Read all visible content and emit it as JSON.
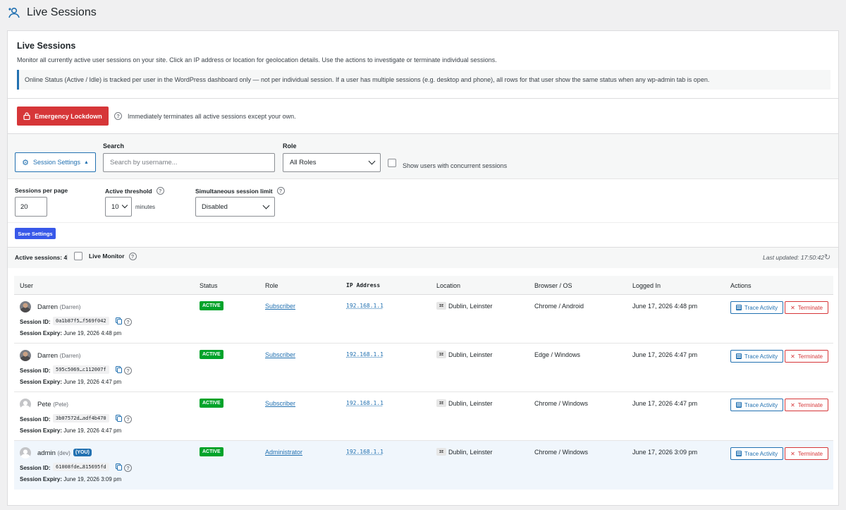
{
  "page": {
    "title": "Live Sessions"
  },
  "intro": {
    "title": "Live Sessions",
    "text": "Monitor all currently active user sessions on your site. Click an IP address or location for geolocation details. Use the actions to investigate or terminate individual sessions.",
    "notice": "Online Status (Active / Idle) is tracked per user in the WordPress dashboard only — not per individual session. If a user has multiple sessions (e.g. desktop and phone), all rows for that user show the same status when any wp-admin tab is open."
  },
  "lockdown": {
    "button_label": "Emergency Lockdown",
    "help_text": "Immediately terminates all active sessions except your own."
  },
  "filters": {
    "settings_button": "Session Settings",
    "search_label": "Search",
    "search_placeholder": "Search by username...",
    "role_label": "Role",
    "role_value": "All Roles",
    "concurrent_label": "Show users with concurrent sessions"
  },
  "settings": {
    "per_page_label": "Sessions per page",
    "per_page_value": "20",
    "threshold_label": "Active threshold",
    "threshold_value": "10",
    "threshold_unit": "minutes",
    "limit_label": "Simultaneous session limit",
    "limit_value": "Disabled",
    "save_label": "Save Settings"
  },
  "summary": {
    "active_sessions": "Active sessions: 4",
    "separator": "|",
    "live_monitor": "Live Monitor",
    "last_updated": "Last updated: 17:50:42"
  },
  "table": {
    "headers": [
      "User",
      "Status",
      "Role",
      "IP Address",
      "Location",
      "Browser / OS",
      "Logged In",
      "Actions"
    ],
    "session_id_label": "Session ID:",
    "session_expiry_label": "Session Expiry:",
    "trace_label": "Trace Activity",
    "terminate_label": "Terminate",
    "rows": [
      {
        "name": "Darren",
        "display": "(Darren)",
        "session_id": "0a1b87f5…f569f042",
        "expiry": "June 19, 2026 4:48 pm",
        "status": "ACTIVE",
        "role": "Subscriber",
        "ip": "192.168.1.1",
        "flag": "IE",
        "location": "Dublin, Leinster",
        "browser": "Chrome / Android",
        "logged_in": "June 17, 2026 4:48 pm"
      },
      {
        "name": "Darren",
        "display": "(Darren)",
        "session_id": "595c5069…c112007f",
        "expiry": "June 19, 2026 4:47 pm",
        "status": "ACTIVE",
        "role": "Subscriber",
        "ip": "192.168.1.1",
        "flag": "IE",
        "location": "Dublin, Leinster",
        "browser": "Edge / Windows",
        "logged_in": "June 17, 2026 4:47 pm"
      },
      {
        "name": "Pete",
        "display": "(Pete)",
        "session_id": "3b07572d…adf4b470",
        "expiry": "June 19, 2026 4:47 pm",
        "status": "ACTIVE",
        "role": "Subscriber",
        "ip": "192.168.1.1",
        "flag": "IE",
        "location": "Dublin, Leinster",
        "browser": "Chrome / Windows",
        "logged_in": "June 17, 2026 4:47 pm"
      },
      {
        "name": "admin",
        "display": "(dev)",
        "you_badge": "(YOU)",
        "session_id": "61008fde…815695fd",
        "expiry": "June 19, 2026 3:09 pm",
        "status": "ACTIVE",
        "role": "Administrator",
        "ip": "192.168.1.1",
        "flag": "IE",
        "location": "Dublin, Leinster",
        "browser": "Chrome / Windows",
        "logged_in": "June 17, 2026 3:09 pm"
      }
    ]
  }
}
